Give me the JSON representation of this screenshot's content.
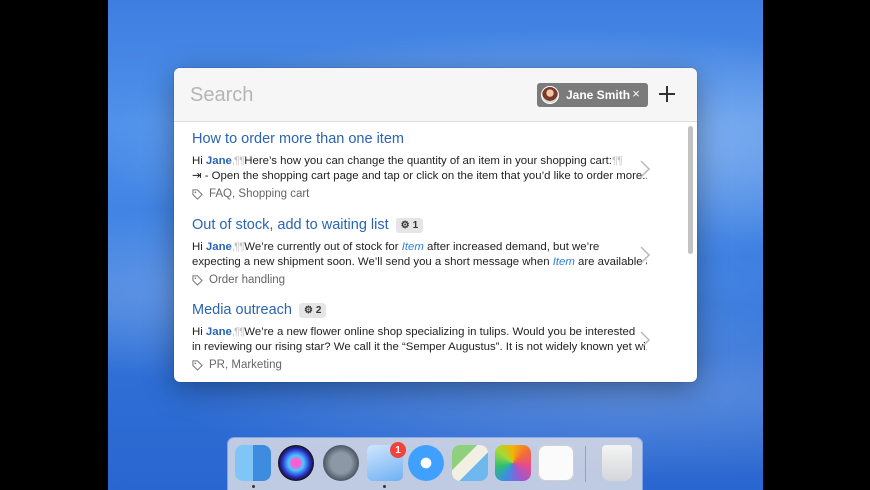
{
  "search": {
    "placeholder": "Search"
  },
  "user_filter": {
    "name": "Jane Smith",
    "remove_symbol": "×"
  },
  "add_symbol": "+",
  "results": [
    {
      "title": "How to order more than one item",
      "badge": null,
      "line1": {
        "pre": "Hi ",
        "name": "Jane",
        "pil": ",¶¶",
        "text": "Here’s how you can change the quantity of an item in your shopping cart:",
        "pil_end": "¶¶"
      },
      "line2": "⇥ - Open the shopping cart page and tap or click on the item that you’d like to order more...",
      "tags": "FAQ, Shopping cart"
    },
    {
      "title": "Out of stock, add to waiting list",
      "badge": "1",
      "line1": {
        "pre": "Hi ",
        "name": "Jane",
        "pil": ",¶¶",
        "text": "We’re  currently out of stock for ",
        "ph": "Item",
        "text2": " after increased demand, but we’re"
      },
      "line2": {
        "text": "expecting a new shipment soon. We’ll send you a short message when ",
        "ph": "Item",
        "text2": " are available a..."
      },
      "tags": "Order handling"
    },
    {
      "title": "Media outreach",
      "badge": "2",
      "line1": {
        "pre": "Hi ",
        "name": "Jane",
        "pil": ",¶¶",
        "text": "We’re a new flower online shop specializing in tulips. Would you be interested"
      },
      "line2": "in reviewing our rising star? We call it the “Semper Augustus”. It is not widely known yet wi...",
      "tags": "PR, Marketing"
    }
  ],
  "dock": {
    "mail_badge": "1",
    "apps": [
      "finder-icon",
      "siri-icon",
      "launchpad-icon",
      "mail-icon",
      "safari-icon",
      "maps-icon",
      "photos-icon",
      "reminders-icon",
      "trash-icon"
    ]
  }
}
